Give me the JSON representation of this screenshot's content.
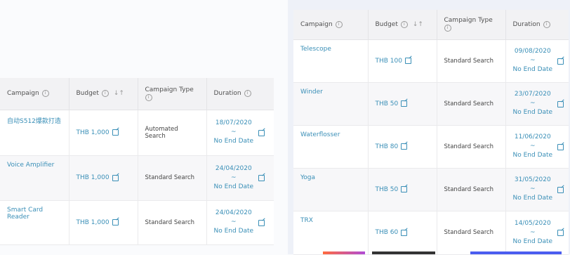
{
  "columns": {
    "campaign": "Campaign",
    "budget": "Budget",
    "campaign_type": "Campaign Type",
    "duration": "Duration"
  },
  "left_table": {
    "rows": [
      {
        "campaign": "自动S512爆款打造",
        "budget": "THB 1,000",
        "type": "Automated Search",
        "start": "18/07/2020",
        "tilde": "~",
        "end": "No End Date"
      },
      {
        "campaign": "Voice Amplifier",
        "budget": "THB 1,000",
        "type": "Standard Search",
        "start": "24/04/2020",
        "tilde": "~",
        "end": "No End Date"
      },
      {
        "campaign": "Smart Card Reader",
        "budget": "THB 1,000",
        "type": "Standard Search",
        "start": "24/04/2020",
        "tilde": "~",
        "end": "No End Date"
      }
    ]
  },
  "right_table": {
    "rows": [
      {
        "campaign": "Telescope",
        "budget": "THB 100",
        "type": "Standard Search",
        "start": "09/08/2020",
        "tilde": "~",
        "end": "No End Date"
      },
      {
        "campaign": "Winder",
        "budget": "THB 50",
        "type": "Standard Search",
        "start": "23/07/2020",
        "tilde": "~",
        "end": "No End Date"
      },
      {
        "campaign": "Waterflosser",
        "budget": "THB 80",
        "type": "Standard Search",
        "start": "11/06/2020",
        "tilde": "~",
        "end": "No End Date"
      },
      {
        "campaign": "Yoga",
        "budget": "THB 50",
        "type": "Standard Search",
        "start": "31/05/2020",
        "tilde": "~",
        "end": "No End Date"
      },
      {
        "campaign": "TRX",
        "budget": "THB 60",
        "type": "Standard Search",
        "start": "14/05/2020",
        "tilde": "~",
        "end": "No End Date"
      }
    ]
  },
  "icons": {
    "info": "info-circle-icon",
    "sort": "sort-arrows-icon",
    "edit": "edit-icon"
  },
  "colors": {
    "link": "#3a8fb7",
    "header_bg": "#f2f2f4"
  }
}
